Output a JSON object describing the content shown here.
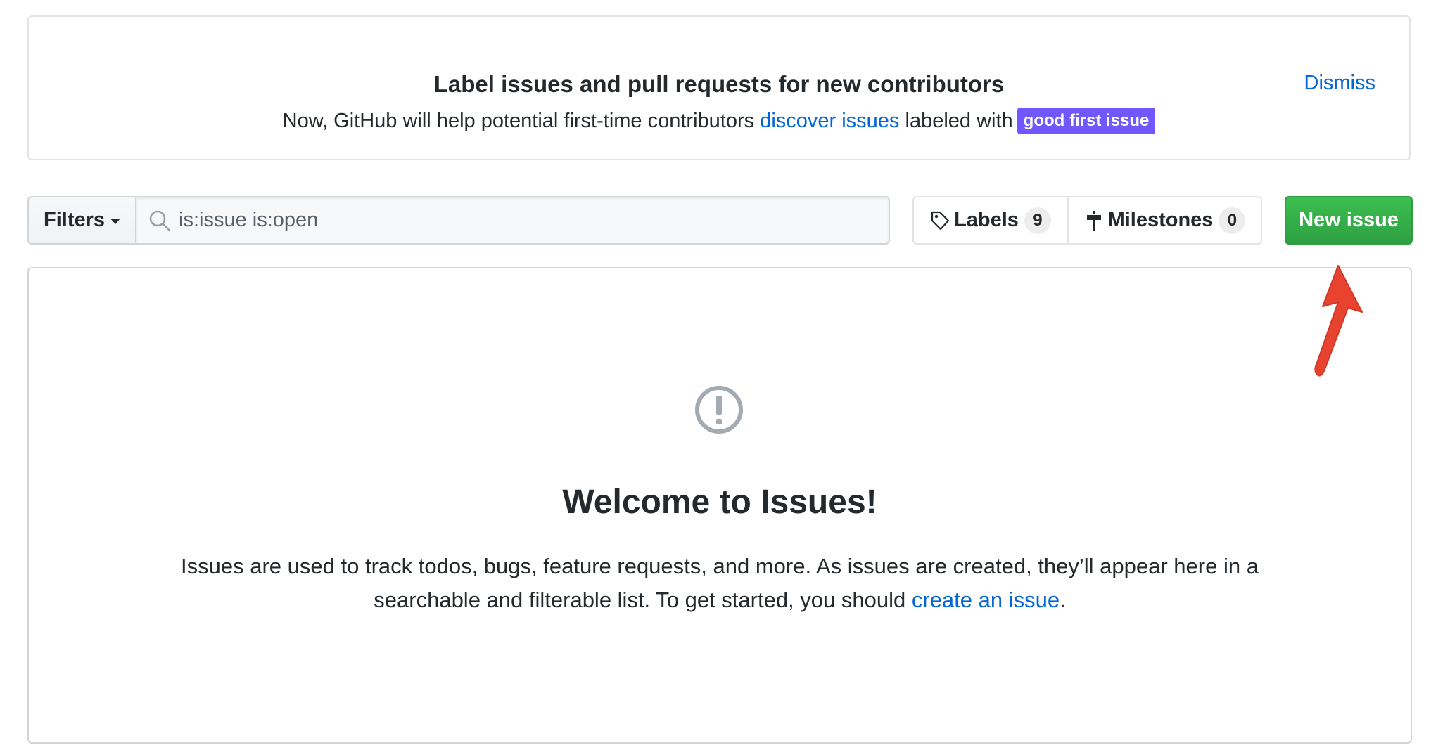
{
  "banner": {
    "title": "Label issues and pull requests for new contributors",
    "text_before": "Now, GitHub will help potential first-time contributors ",
    "link_text": "discover issues",
    "text_after": " labeled with",
    "label_badge": "good first issue",
    "dismiss": "Dismiss"
  },
  "toolbar": {
    "filters_label": "Filters",
    "search_value": "is:issue is:open",
    "labels_label": "Labels",
    "labels_count": "9",
    "milestones_label": "Milestones",
    "milestones_count": "0",
    "new_issue_label": "New issue"
  },
  "blankslate": {
    "title": "Welcome to Issues!",
    "text_before": "Issues are used to track todos, bugs, feature requests, and more. As issues are created, they’ll appear here in a searchable and filterable list. To get started, you should ",
    "link_text": "create an issue",
    "text_after": "."
  },
  "icons": {
    "search": "search-icon",
    "labels": "tag-icon",
    "milestones": "milestone-icon",
    "alert": "issue-opened-icon",
    "annotation": "red-arrow-icon"
  },
  "colors": {
    "link": "#0366d6",
    "good_first_issue_bg": "#7057ff",
    "new_issue_green": "#2ea043",
    "annotation_red": "#e8432f"
  }
}
